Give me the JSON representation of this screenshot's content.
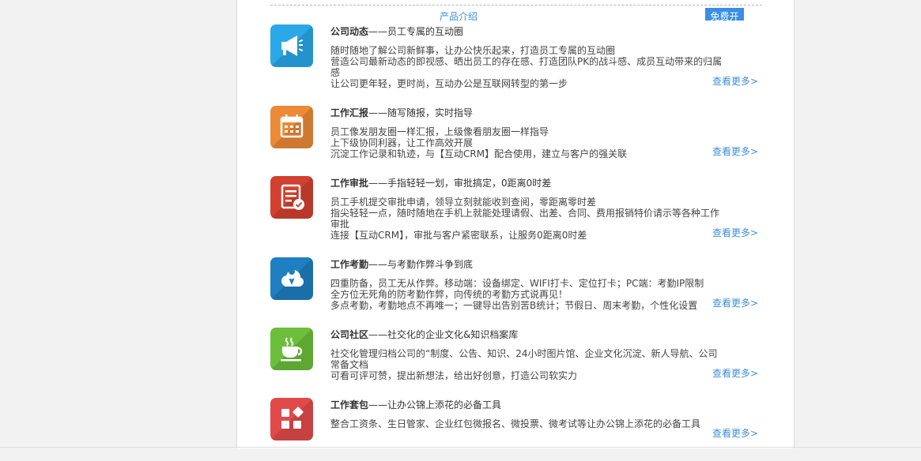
{
  "header": {
    "tab_label": "产品介绍",
    "free_button": "免费开"
  },
  "features": [
    {
      "icon": "megaphone-icon",
      "color": "#2aa8e8",
      "title": "公司动态",
      "subtitle": "——员工专属的互动圈",
      "lines": [
        "随时随地了解公司新鲜事，让办公快乐起来，打造员工专属的互动圈",
        "营造公司最新动态的即视感、晒出员工的存在感、打造团队PK的战斗感、成员互动带来的归属感",
        "让公司更年轻，更时尚，互动办公是互联网转型的第一步"
      ],
      "more": "查看更多>"
    },
    {
      "icon": "calendar-icon",
      "color": "#ec8a37",
      "title": "工作汇报",
      "subtitle": "——随写随报，实时指导",
      "lines": [
        "员工像发朋友圈一样汇报，上级像看朋友圈一样指导",
        "上下级协同利器，让工作高效开展",
        "沉淀工作记录和轨迹，与【互动CRM】配合使用，建立与客户的强关联"
      ],
      "more": "查看更多>"
    },
    {
      "icon": "approval-document-icon",
      "color": "#d2412f",
      "title": "工作审批",
      "subtitle": "——手指轻轻一划，审批搞定，0距离0时差",
      "lines": [
        "员工手机提交审批申请，领导立刻就能收到查阅，零距离零时差",
        "指尖轻轻一点，随时随地在手机上就能处理请假、出差、合同、费用报销特价请示等各种工作审批",
        "连接【互动CRM】，审批与客户紧密联系，让服务0距离0时差"
      ],
      "more": "查看更多>"
    },
    {
      "icon": "cloud-location-icon",
      "color": "#1f7fc0",
      "title": "工作考勤",
      "subtitle": "——与考勤作弊斗争到底",
      "lines": [
        "四重防备，员工无从作弊。移动端：设备绑定、WIFI打卡、定位打卡；PC端：考勤IP限制",
        "全方位无死角的防考勤作弊，向传统的考勤方式说再见！",
        "多点考勤，考勤地点不再唯一；一键导出告别苦B统计；节假日、周末考勤，个性化设置"
      ],
      "more": "查看更多>"
    },
    {
      "icon": "coffee-cup-icon",
      "color": "#6cbf3a",
      "title": "公司社区",
      "subtitle": "——社交化的企业文化&知识档案库",
      "lines": [
        "社交化管理归档公司的“制度、公告、知识、24小时图片馆、企业文化沉淀、新人导航、公司常备文档",
        "可看可评可赞，提出新想法，给出好创意，打造公司软实力"
      ],
      "more": "查看更多>"
    },
    {
      "icon": "toolkit-grid-icon",
      "color": "#e24a4a",
      "title": "工作套包",
      "subtitle": "——让办公锦上添花的必备工具",
      "lines": [
        "整合工资条、生日管家、企业红包微报名、微投票、微考试等让办公锦上添花的必备工具"
      ],
      "more": "查看更多>"
    }
  ]
}
